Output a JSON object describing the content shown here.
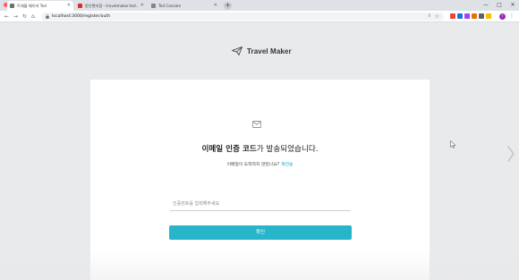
{
  "browser": {
    "tabs": [
      {
        "title": "트래블 메이커 Ted",
        "active": true,
        "favicon_color": "#6b6f78"
      },
      {
        "title": "받은편지함 - travelmaker.ted...",
        "active": false,
        "favicon_color": "#d93025"
      },
      {
        "title": "Ted Console",
        "active": false,
        "favicon_color": "#80868b"
      }
    ],
    "new_tab": "+",
    "url": "localhost:3000/register/auth",
    "window_controls": {
      "minimize": "—",
      "maximize": "□",
      "close": "✕"
    },
    "profile_initial": "T",
    "extension_colors": [
      "#ea4335",
      "#1a73e8",
      "#a142f4",
      "#e37400",
      "#5f6368",
      "#fbbc04"
    ],
    "icons": [
      "back-arrow-icon",
      "forward-arrow-icon",
      "reload-icon",
      "home-icon",
      "lock-icon",
      "share-icon",
      "star-icon",
      "menu-dots-icon"
    ]
  },
  "brand": {
    "name": "Travel Maker",
    "logo_icon": "paper-plane-icon"
  },
  "verify": {
    "mail_icon": "envelope-icon",
    "headline_bold": "이메일 인증 코드",
    "headline_rest": "가 발송되었습니다.",
    "sub_text": "이메일이 도착하지 않았나요?",
    "resend_link": "재전송",
    "code_placeholder": "인증번호를 입력해주세요",
    "code_value": "",
    "confirm_label": "확인"
  },
  "colors": {
    "accent_button": "#27b5c9",
    "link": "#1a9fd6",
    "page_bg": "#e9eaec"
  }
}
